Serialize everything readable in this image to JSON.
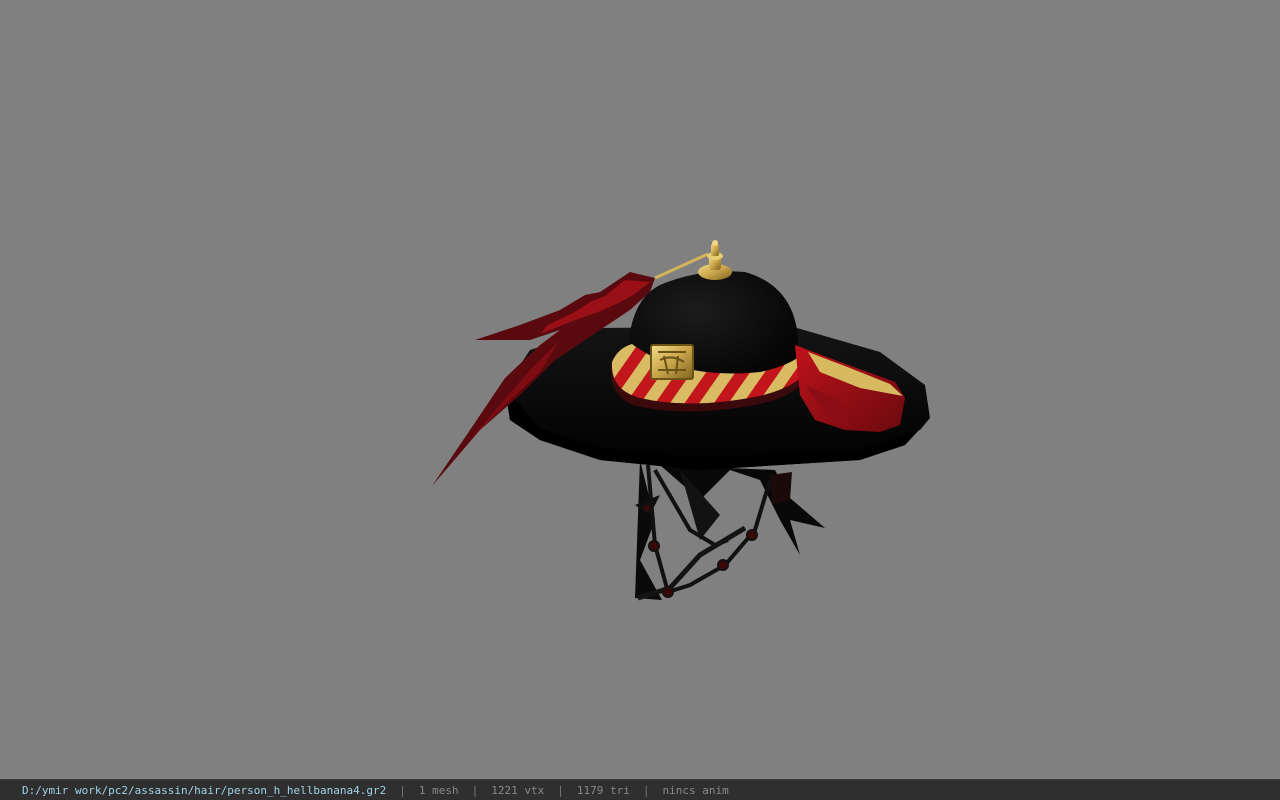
{
  "viewer": {
    "background_color": "#808080",
    "model_name": "person_h_hellbanana4"
  },
  "status_bar": {
    "file_path": "D:/ymir work/pc2/assassin/hair/person_h_hellbanana4.gr2",
    "separator": "|",
    "mesh_count": "1 mesh",
    "vertex_count": "1221 vtx",
    "triangle_count": "1179 tri",
    "animation": "nincs anim",
    "path_color": "#9fd3e8",
    "text_color": "#8a8a8a"
  }
}
